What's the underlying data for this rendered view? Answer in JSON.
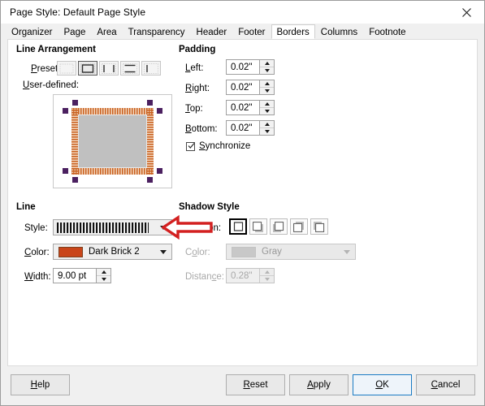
{
  "window": {
    "title": "Page Style: Default Page Style",
    "close_icon": "close-icon"
  },
  "tabs": [
    {
      "label": "Organizer",
      "active": false
    },
    {
      "label": "Page",
      "active": false
    },
    {
      "label": "Area",
      "active": false
    },
    {
      "label": "Transparency",
      "active": false
    },
    {
      "label": "Header",
      "active": false
    },
    {
      "label": "Footer",
      "active": false
    },
    {
      "label": "Borders",
      "active": true
    },
    {
      "label": "Columns",
      "active": false
    },
    {
      "label": "Footnote",
      "active": false
    }
  ],
  "line_arrangement": {
    "title": "Line Arrangement",
    "presets_label": "Presets:",
    "presets": [
      {
        "name": "preset-no-borders",
        "selected": false
      },
      {
        "name": "preset-box",
        "selected": true
      },
      {
        "name": "preset-left-right",
        "selected": false
      },
      {
        "name": "preset-top-bottom",
        "selected": false
      },
      {
        "name": "preset-left-only",
        "selected": false
      }
    ],
    "userdefined_label": "User-defined:",
    "preview": {
      "border_color": "#c9601f",
      "fill_color": "#c0c0c0",
      "handle_color": "#4b2060"
    }
  },
  "padding": {
    "title": "Padding",
    "fields": [
      {
        "label": "Left:",
        "value": "0.02\"",
        "name": "padding-left-field"
      },
      {
        "label": "Right:",
        "value": "0.02\"",
        "name": "padding-right-field"
      },
      {
        "label": "Top:",
        "value": "0.02\"",
        "name": "padding-top-field"
      },
      {
        "label": "Bottom:",
        "value": "0.02\"",
        "name": "padding-bottom-field"
      }
    ],
    "synchronize_label": "Synchronize",
    "synchronize_checked": true
  },
  "line": {
    "title": "Line",
    "style_label": "Style:",
    "style_value": "",
    "color_label": "Color:",
    "color_value": "Dark Brick 2",
    "color_hex": "#c9451a",
    "width_label": "Width:",
    "width_value": "9.00 pt"
  },
  "shadow": {
    "title": "Shadow Style",
    "position_label": "Position:",
    "positions": [
      {
        "name": "shadow-none",
        "selected": true
      },
      {
        "name": "shadow-bottom-right",
        "selected": false
      },
      {
        "name": "shadow-bottom-left",
        "selected": false
      },
      {
        "name": "shadow-top-right",
        "selected": false
      },
      {
        "name": "shadow-top-left",
        "selected": false
      }
    ],
    "color_label": "Color:",
    "color_value": "Gray",
    "color_hex": "#c8c8c8",
    "distance_label": "Distance:",
    "distance_value": "0.28\""
  },
  "annotation": {
    "arrow_color": "#d32020",
    "arrow_points_to": "line-style-combo"
  },
  "buttons": {
    "help": "Help",
    "reset": "Reset",
    "apply": "Apply",
    "ok": "OK",
    "cancel": "Cancel"
  }
}
